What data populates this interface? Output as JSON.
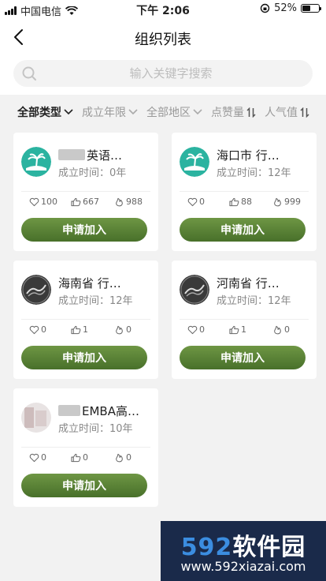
{
  "status": {
    "carrier": "中国电信",
    "time": "下午 2:06",
    "battery": "52%",
    "battery_level": 0.52
  },
  "nav": {
    "title": "组织列表"
  },
  "search": {
    "placeholder": "输入关键字搜索"
  },
  "filters": [
    {
      "label": "全部类型"
    },
    {
      "label": "成立年限"
    },
    {
      "label": "全部地区"
    },
    {
      "label": "点赞量"
    },
    {
      "label": "人气值"
    }
  ],
  "cards": [
    {
      "name": "英语…",
      "founded": "成立时间：0年",
      "likes": "100",
      "thumbs": "667",
      "popularity": "988",
      "join": "申请加入",
      "logo": "palm-island-logo"
    },
    {
      "name": "海口市 行…",
      "founded": "成立时间：12年",
      "likes": "0",
      "thumbs": "88",
      "popularity": "999",
      "join": "申请加入",
      "logo": "palm-island-logo"
    },
    {
      "name": "海南省 行…",
      "founded": "成立时间：12年",
      "likes": "0",
      "thumbs": "1",
      "popularity": "0",
      "join": "申请加入",
      "logo": "dark-wave-logo"
    },
    {
      "name": "河南省 行…",
      "founded": "成立时间：12年",
      "likes": "0",
      "thumbs": "1",
      "popularity": "0",
      "join": "申请加入",
      "logo": "dark-wave-logo"
    },
    {
      "name": "EMBA高…",
      "founded": "成立时间：10年",
      "likes": "0",
      "thumbs": "0",
      "popularity": "0",
      "join": "申请加入",
      "logo": "blurred-logo"
    }
  ],
  "watermark": {
    "brand_digits": "592",
    "brand_text": "软件园",
    "url": "www.592xiazai.com"
  },
  "colors": {
    "accent": "#5a8236",
    "teal": "#2bb3a0"
  }
}
